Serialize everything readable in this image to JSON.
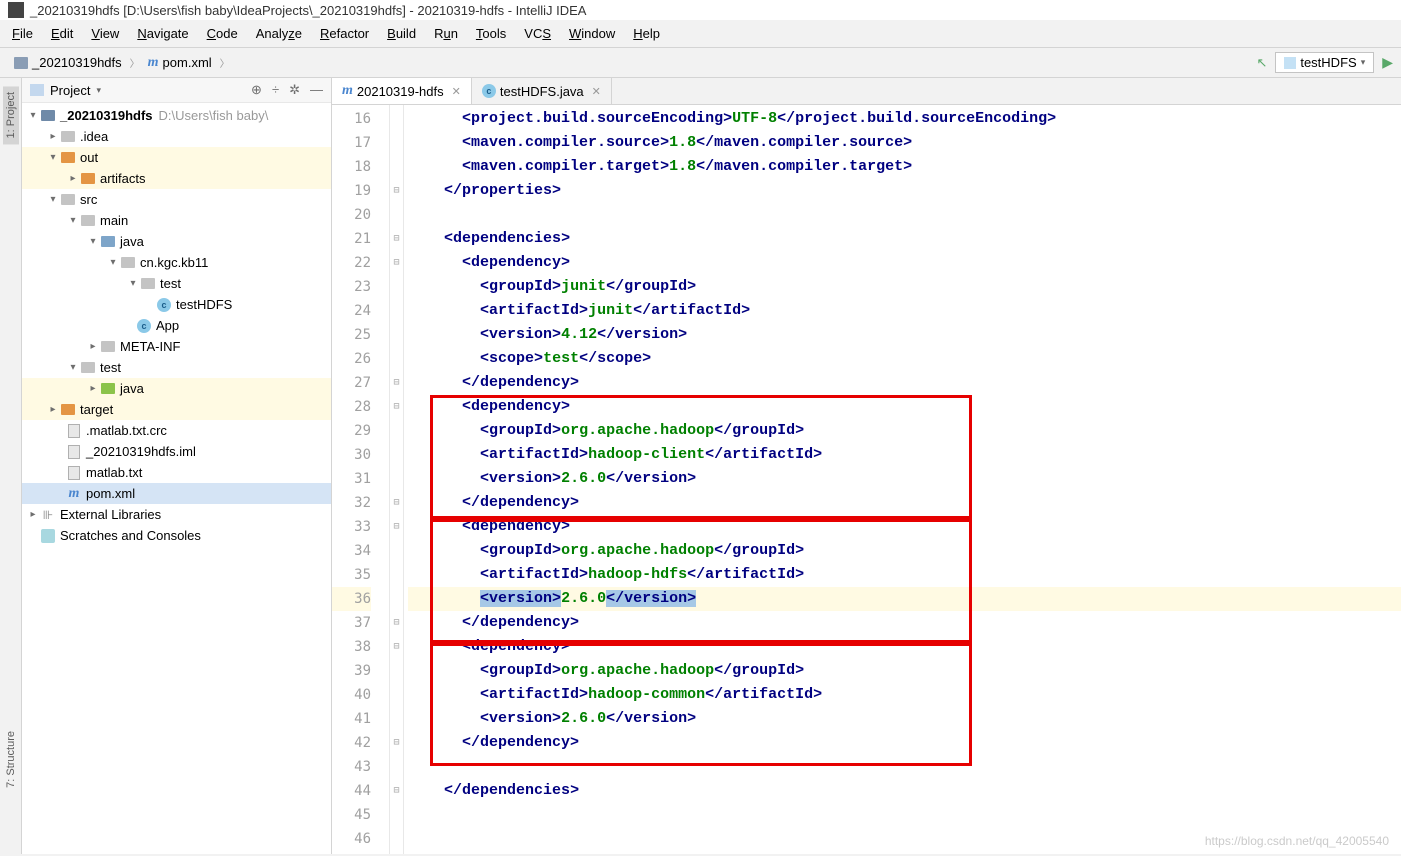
{
  "window": {
    "title": "_20210319hdfs [D:\\Users\\fish baby\\IdeaProjects\\_20210319hdfs] - 20210319-hdfs - IntelliJ IDEA"
  },
  "menu": [
    "File",
    "Edit",
    "View",
    "Navigate",
    "Code",
    "Analyze",
    "Refactor",
    "Build",
    "Run",
    "Tools",
    "VCS",
    "Window",
    "Help"
  ],
  "breadcrumb": {
    "root": "_20210319hdfs",
    "file": "pom.xml"
  },
  "run_config": "testHDFS",
  "project_panel": {
    "title": "Project",
    "root": {
      "name": "_20210319hdfs",
      "hint": "D:\\Users\\fish baby\\"
    },
    "idea": ".idea",
    "out": "out",
    "artifacts": "artifacts",
    "src": "src",
    "main": "main",
    "java": "java",
    "pkg": "cn.kgc.kb11",
    "test": "test",
    "testHDFS": "testHDFS",
    "app": "App",
    "meta": "META-INF",
    "test2": "test",
    "java2": "java",
    "target": "target",
    "f1": ".matlab.txt.crc",
    "f2": "_20210319hdfs.iml",
    "f3": "matlab.txt",
    "f4": "pom.xml",
    "ext": "External Libraries",
    "scratch": "Scratches and Consoles"
  },
  "editor": {
    "tab1": "20210319-hdfs",
    "tab2": "testHDFS.java"
  },
  "lines": {
    "start": 16,
    "count": 31
  },
  "code": {
    "l16": {
      "i": 3,
      "open": "project.build.sourceEncoding",
      "txt": "UTF-8",
      "close": "project.build.sourceEncoding"
    },
    "l17": {
      "i": 3,
      "open": "maven.compiler.source",
      "txt": "1.8",
      "close": "maven.compiler.source"
    },
    "l18": {
      "i": 3,
      "open": "maven.compiler.target",
      "txt": "1.8",
      "close": "maven.compiler.target"
    },
    "l19": {
      "i": 2,
      "close": "properties"
    },
    "l21": {
      "i": 2,
      "open": "dependencies"
    },
    "l22": {
      "i": 3,
      "open": "dependency"
    },
    "l23": {
      "i": 4,
      "open": "groupId",
      "txt": "junit",
      "close": "groupId"
    },
    "l24": {
      "i": 4,
      "open": "artifactId",
      "txt": "junit",
      "close": "artifactId"
    },
    "l25": {
      "i": 4,
      "open": "version",
      "txt": "4.12",
      "close": "version"
    },
    "l26": {
      "i": 4,
      "open": "scope",
      "txt": "test",
      "close": "scope"
    },
    "l27": {
      "i": 3,
      "close": "dependency"
    },
    "l28": {
      "i": 3,
      "open": "dependency"
    },
    "l29": {
      "i": 4,
      "open": "groupId",
      "txt": "org.apache.hadoop",
      "close": "groupId"
    },
    "l30": {
      "i": 4,
      "open": "artifactId",
      "txt": "hadoop-client",
      "close": "artifactId"
    },
    "l31": {
      "i": 4,
      "open": "version",
      "txt": "2.6.0",
      "close": "version"
    },
    "l32": {
      "i": 3,
      "close": "dependency"
    },
    "l33": {
      "i": 3,
      "open": "dependency"
    },
    "l34": {
      "i": 4,
      "open": "groupId",
      "txt": "org.apache.hadoop",
      "close": "groupId"
    },
    "l35": {
      "i": 4,
      "open": "artifactId",
      "txt": "hadoop-hdfs",
      "close": "artifactId"
    },
    "l36": {
      "i": 4,
      "open": "version",
      "txt": "2.6.0",
      "close": "version",
      "sel": true
    },
    "l37": {
      "i": 3,
      "close": "dependency"
    },
    "l38": {
      "i": 3,
      "open": "dependency"
    },
    "l39": {
      "i": 4,
      "open": "groupId",
      "txt": "org.apache.hadoop",
      "close": "groupId"
    },
    "l40": {
      "i": 4,
      "open": "artifactId",
      "txt": "hadoop-common",
      "close": "artifactId"
    },
    "l41": {
      "i": 4,
      "open": "version",
      "txt": "2.6.0",
      "close": "version"
    },
    "l42": {
      "i": 3,
      "close": "dependency"
    },
    "l44": {
      "i": 2,
      "close": "dependencies"
    }
  },
  "watermark": "https://blog.csdn.net/qq_42005540",
  "sidestrip": {
    "project": "1: Project",
    "structure": "7: Structure"
  }
}
